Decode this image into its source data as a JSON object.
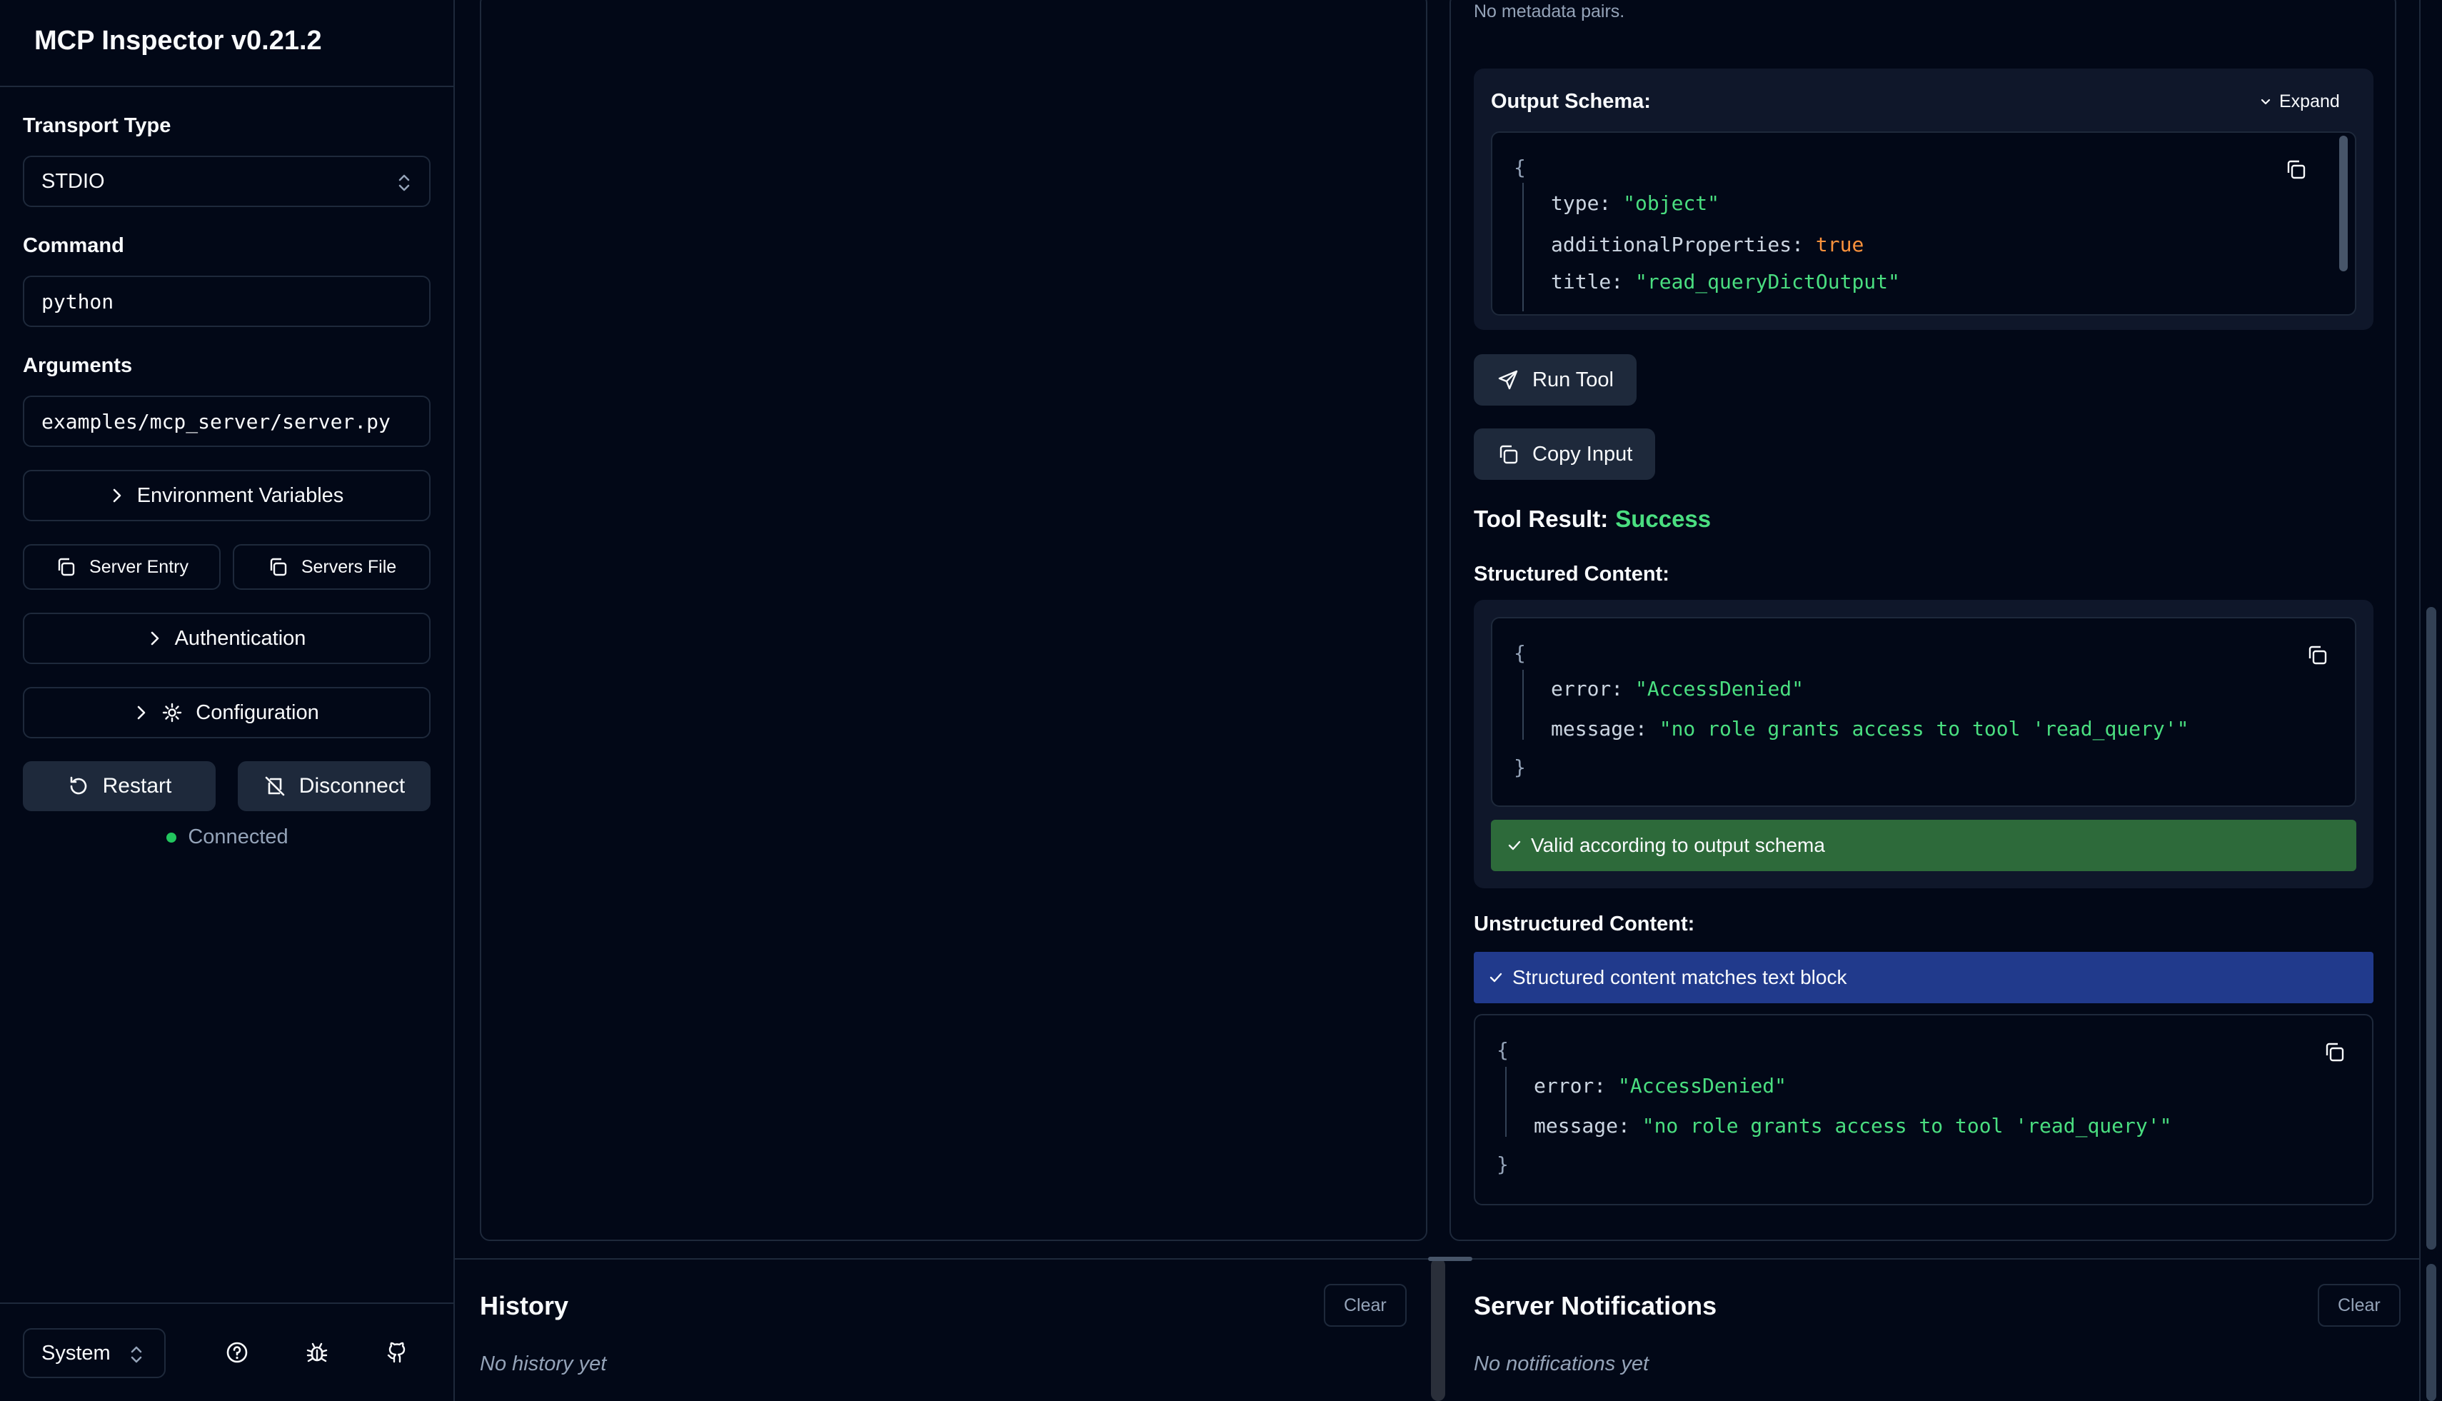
{
  "app": {
    "title": "MCP Inspector v0.21.2"
  },
  "sidebar": {
    "transport_label": "Transport Type",
    "transport_value": "STDIO",
    "command_label": "Command",
    "command_value": "python",
    "arguments_label": "Arguments",
    "arguments_value": "examples/mcp_server/server.py",
    "env_vars_label": "Environment Variables",
    "server_entry_label": "Server Entry",
    "servers_file_label": "Servers File",
    "authentication_label": "Authentication",
    "configuration_label": "Configuration",
    "restart_label": "Restart",
    "disconnect_label": "Disconnect",
    "status": "Connected",
    "status_color": "#22c55e",
    "theme_value": "System",
    "footer_icons": [
      "help-icon",
      "bug-icon",
      "github-icon"
    ]
  },
  "tool": {
    "metadata_note": "No metadata pairs.",
    "output_schema_label": "Output Schema:",
    "expand_label": "Expand",
    "schema": {
      "open_brace": "{",
      "type_key": "type:",
      "type_value": "\"object\"",
      "additional_key": "additionalProperties:",
      "additional_value": "true",
      "title_key": "title:",
      "title_value": "\"read_queryDictOutput\""
    },
    "run_tool_label": "Run Tool",
    "copy_input_label": "Copy Input",
    "result_label": "Tool Result:",
    "result_status": "Success",
    "result_status_color": "#4ade80",
    "structured_label": "Structured Content:",
    "structured": {
      "open_brace": "{",
      "error_key": "error:",
      "error_value": "\"AccessDenied\"",
      "message_key": "message:",
      "message_value": "\"no role grants access to tool 'read_query'\"",
      "close_brace": "}"
    },
    "valid_banner": "Valid according to output schema",
    "valid_banner_color": "#2d6a3a",
    "unstructured_label": "Unstructured Content:",
    "match_banner": "Structured content matches text block",
    "match_banner_color": "#213a8c",
    "unstructured": {
      "open_brace": "{",
      "error_key": "error:",
      "error_value": "\"AccessDenied\"",
      "message_key": "message:",
      "message_value": "\"no role grants access to tool 'read_query'\"",
      "close_brace": "}"
    }
  },
  "history": {
    "title": "History",
    "clear_label": "Clear",
    "empty_text": "No history yet"
  },
  "notifications": {
    "title": "Server Notifications",
    "clear_label": "Clear",
    "empty_text": "No notifications yet"
  }
}
